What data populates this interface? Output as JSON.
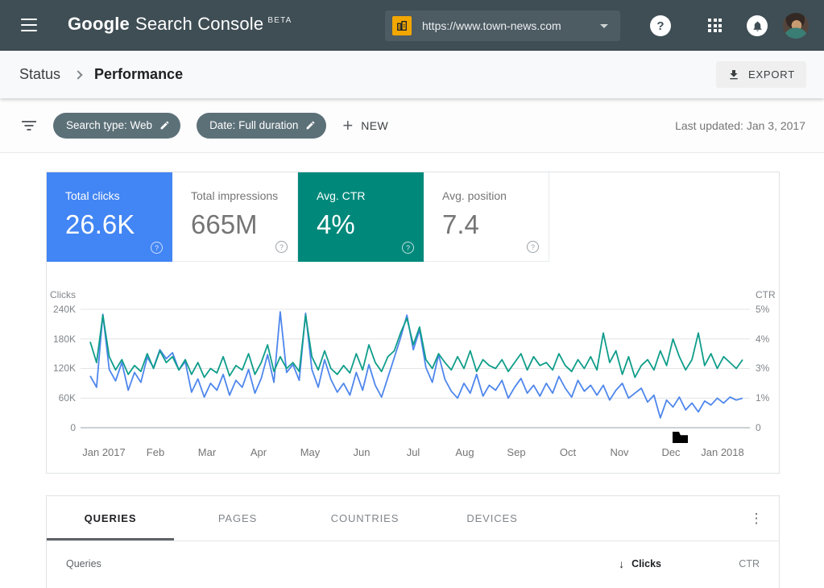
{
  "icons": {
    "help": "?",
    "more_vert": "⋮",
    "plus": "+",
    "sort_desc": "↓"
  },
  "topbar": {
    "logo_google": "Google",
    "logo_product": "Search Console",
    "logo_beta": "BETA",
    "property_url": "https://www.town-news.com",
    "colors": {
      "bar_bg": "#3f4e55",
      "selector_bg": "#4d5b62",
      "property_icon_bg": "#f2a600"
    }
  },
  "breadcrumb": {
    "parent": "Status",
    "current": "Performance"
  },
  "export_button": {
    "label": "EXPORT"
  },
  "filter_bar": {
    "chips": [
      {
        "label": "Search type: Web"
      },
      {
        "label": "Date: Full duration"
      }
    ],
    "new_button_label": "NEW",
    "last_updated": "Last updated: Jan 3, 2017",
    "chip_bg": "#5c7078"
  },
  "metrics": {
    "cards": [
      {
        "label": "Total clicks",
        "value": "26.6K",
        "selected": true,
        "bg": "#4285f4"
      },
      {
        "label": "Total impressions",
        "value": "665M",
        "selected": false,
        "bg": "#ffffff"
      },
      {
        "label": "Avg. CTR",
        "value": "4%",
        "selected": true,
        "bg": "#00897b"
      },
      {
        "label": "Avg. position",
        "value": "7.4",
        "selected": false,
        "bg": "#ffffff"
      }
    ]
  },
  "chart_data": {
    "type": "line",
    "title": "",
    "grid": true,
    "legend_position": "none",
    "x_labels": [
      "Jan 2017",
      "Feb",
      "Mar",
      "Apr",
      "May",
      "Jun",
      "Jul",
      "Aug",
      "Sep",
      "Oct",
      "Nov",
      "Dec",
      "Jan 2018"
    ],
    "left_axis": {
      "title": "Clicks",
      "ticks": [
        "240K",
        "180K",
        "120K",
        "60K",
        "0"
      ],
      "tick_values_k": [
        240,
        180,
        120,
        60,
        0
      ],
      "max_k": 240
    },
    "right_axis": {
      "title": "CTR",
      "ticks": [
        "5%",
        "4%",
        "3%",
        "1%",
        "0"
      ],
      "note": "tick labels share the same gridlines as the left axis: 5%→240K, 4%→180K, 3%→120K, 1%→60K, 0→0"
    },
    "series": [
      {
        "name": "Clicks",
        "unit": "thousands",
        "color": "#4e86ec",
        "values": [
          105,
          82,
          230,
          118,
          95,
          132,
          76,
          112,
          92,
          143,
          122,
          158,
          140,
          152,
          117,
          134,
          72,
          99,
          62,
          90,
          76,
          108,
          66,
          96,
          82,
          118,
          70,
          100,
          148,
          92,
          235,
          112,
          128,
          96,
          232,
          118,
          82,
          138,
          98,
          72,
          90,
          66,
          112,
          76,
          128,
          86,
          62,
          102,
          142,
          182,
          228,
          158,
          198,
          122,
          92,
          148,
          98,
          74,
          60,
          90,
          70,
          108,
          64,
          86,
          76,
          96,
          60,
          82,
          100,
          70,
          86,
          64,
          90,
          70,
          104,
          80,
          62,
          96,
          74,
          86,
          66,
          86,
          56,
          76,
          90,
          60,
          70,
          80,
          52,
          66,
          20,
          56,
          42,
          62,
          36,
          50,
          32,
          54,
          46,
          60,
          50,
          62,
          56,
          60
        ]
      },
      {
        "name": "CTR",
        "unit": "percent",
        "color": "#0f9d8a",
        "values": [
          3.9,
          3.2,
          4.8,
          3.4,
          2.9,
          3.3,
          2.6,
          3.1,
          2.8,
          3.5,
          3.0,
          3.6,
          3.2,
          3.4,
          2.9,
          3.3,
          2.6,
          3.2,
          2.4,
          3.0,
          2.7,
          3.4,
          2.5,
          3.1,
          2.9,
          3.5,
          2.6,
          3.2,
          3.8,
          2.8,
          3.4,
          3.0,
          3.2,
          2.8,
          4.8,
          3.4,
          2.9,
          3.6,
          3.0,
          2.6,
          3.1,
          2.7,
          3.5,
          2.9,
          3.8,
          3.2,
          2.8,
          3.4,
          3.6,
          4.2,
          4.7,
          3.8,
          4.4,
          3.3,
          3.0,
          3.5,
          3.2,
          2.9,
          3.4,
          3.0,
          3.6,
          2.8,
          3.3,
          3.1,
          3.0,
          3.3,
          2.8,
          3.2,
          3.5,
          2.9,
          3.4,
          3.1,
          3.2,
          2.9,
          3.5,
          3.1,
          2.8,
          3.3,
          3.0,
          3.4,
          2.9,
          4.2,
          3.2,
          3.6,
          2.6,
          3.4,
          2.4,
          3.1,
          3.3,
          2.9,
          3.6,
          3.1,
          4.0,
          3.4,
          2.9,
          3.3,
          4.2,
          3.1,
          3.5,
          3.0,
          3.4,
          3.2,
          3.0,
          3.3
        ]
      }
    ]
  },
  "tabs": {
    "items": [
      {
        "label": "QUERIES",
        "active": true
      },
      {
        "label": "PAGES",
        "active": false
      },
      {
        "label": "COUNTRIES",
        "active": false
      },
      {
        "label": "DEVICES",
        "active": false
      }
    ]
  },
  "table": {
    "header": {
      "col1": "Queries",
      "sort_col": "Clicks",
      "col3": "CTR"
    }
  }
}
